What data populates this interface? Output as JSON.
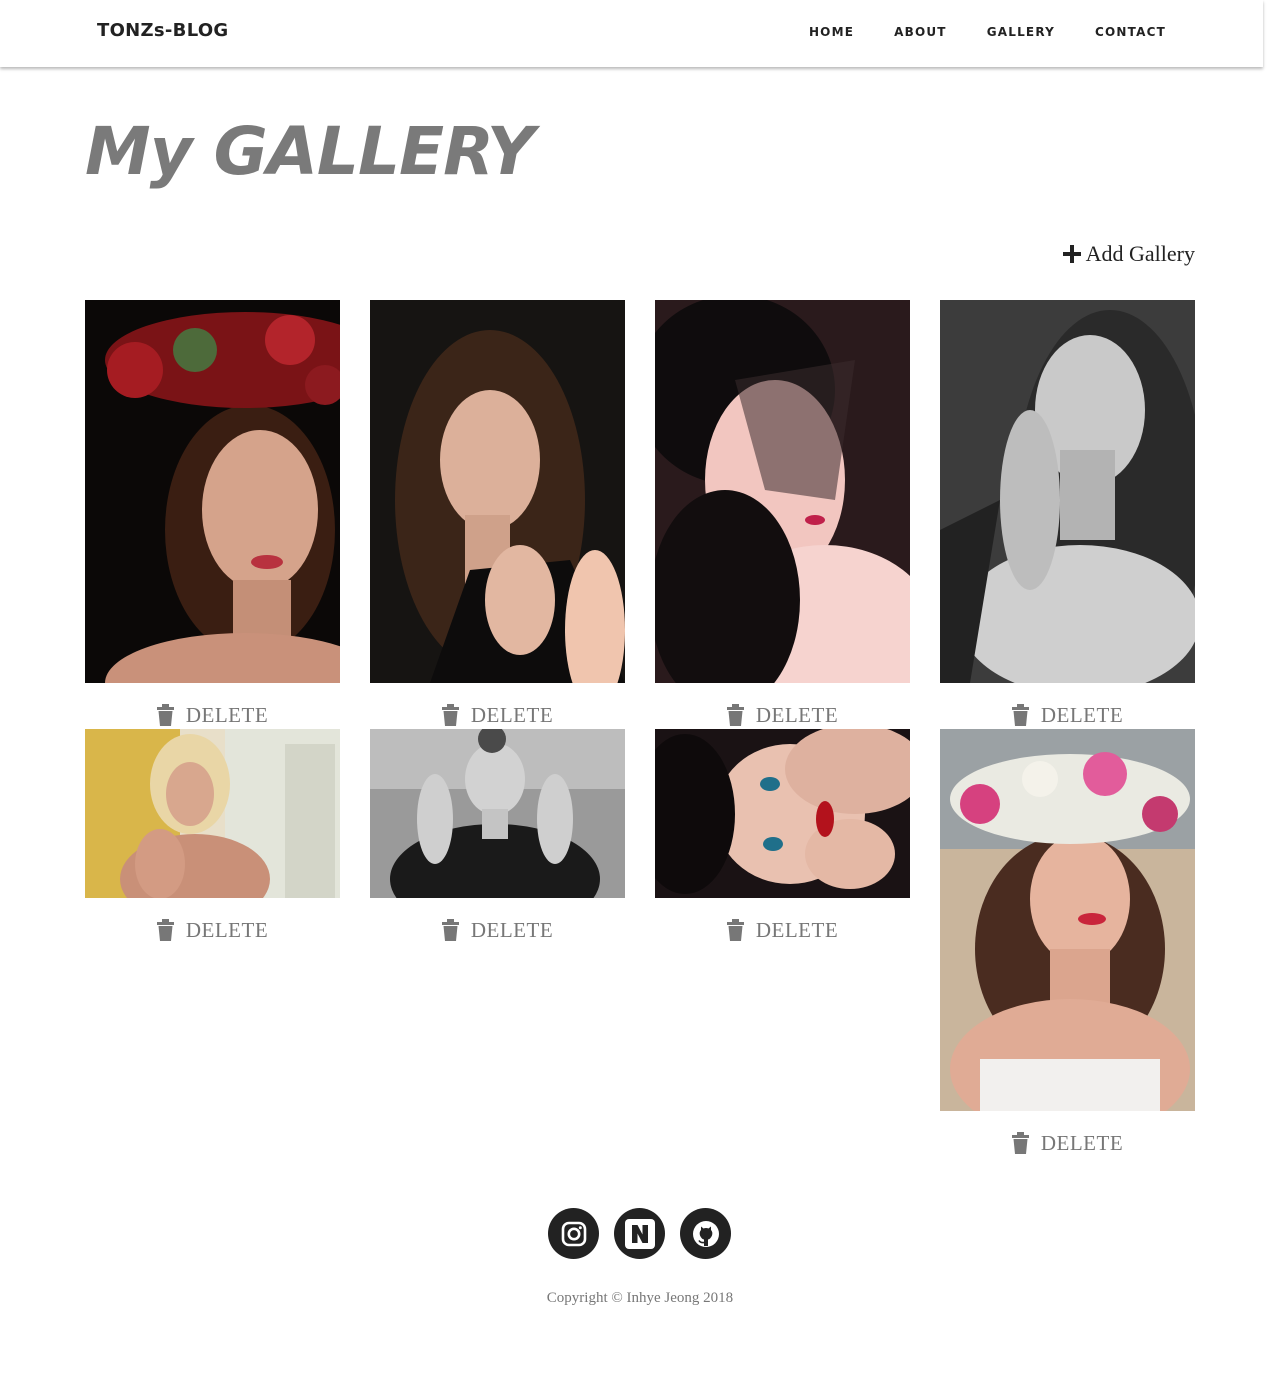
{
  "navbar": {
    "brand": "TONZs-BLOG",
    "links": [
      "HOME",
      "ABOUT",
      "GALLERY",
      "CONTACT"
    ]
  },
  "page": {
    "title": "My GALLERY",
    "add_label": "Add Gallery"
  },
  "gallery": {
    "delete_label": "DELETE",
    "items": [
      {
        "alt": "portrait with flower crown"
      },
      {
        "alt": "portrait in black"
      },
      {
        "alt": "portrait with veil"
      },
      {
        "alt": "black and white portrait"
      },
      {
        "alt": "portrait by yellow wall"
      },
      {
        "alt": "black and white portrait outdoors"
      },
      {
        "alt": "portrait with blue eyes"
      },
      {
        "alt": "portrait with flower crown outdoors"
      }
    ]
  },
  "footer": {
    "social": [
      "instagram",
      "naver",
      "github"
    ],
    "copyright": "Copyright © Inhye Jeong 2018"
  }
}
